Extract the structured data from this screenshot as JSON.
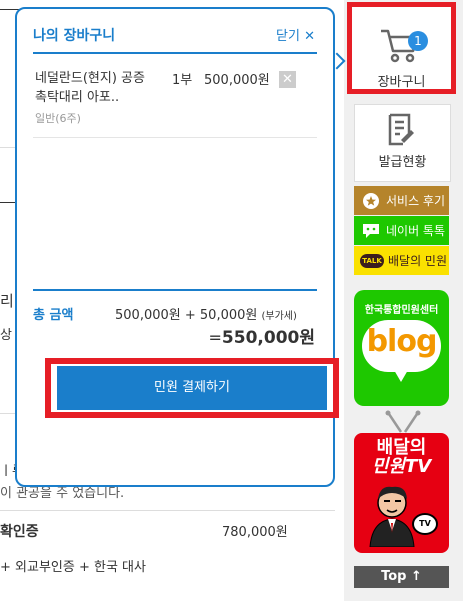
{
  "background": {
    "fragment_1": "리",
    "fragment_2": "상",
    "fragment_3": "ㅣ류",
    "fragment_4": "이 관공을 주 었습니다.",
    "row_label": "확인증",
    "row_price": "780,000원",
    "row_desc": "+ 외교부인증 + 한국 대사"
  },
  "cart_popup": {
    "title": "나의 장바구니",
    "close_label": "닫기 ✕",
    "items": [
      {
        "name": "네덜란드(현지) 공증촉탁대리 아포..",
        "type": "일반(6주)",
        "quantity": "1부",
        "price": "500,000원",
        "delete_icon": "close-icon"
      }
    ],
    "total_label": "총 금액",
    "subtotal": "500,000원",
    "plus": "+",
    "vat_amount": "50,000원",
    "vat_label": "(부가세)",
    "equals": "=",
    "grand_total": "550,000원",
    "pay_button": "민원 결제하기"
  },
  "sidebar": {
    "cart": {
      "label": "장바구니",
      "badge": "1",
      "icon": "cart-icon"
    },
    "issue_status": {
      "label": "발급현황",
      "icon": "document-icon"
    },
    "service_review": {
      "label": "서비스 후기",
      "color": "#b5842b"
    },
    "naver_talk": {
      "label": "네이버 톡톡",
      "color": "#1ec800"
    },
    "kakao": {
      "label": "배달의 민원",
      "icon_text": "TALK",
      "color": "#fae100"
    },
    "blog": {
      "top_text": "한국통합민원센터",
      "word": "blog",
      "color": "#1ec800"
    },
    "tv": {
      "line1": "배달의",
      "line2": "민원TV",
      "badge": "TV",
      "color": "#e60012"
    },
    "top_button": "Top ↑"
  },
  "colors": {
    "accent": "#1a7ecb",
    "highlight": "#e61e26"
  }
}
